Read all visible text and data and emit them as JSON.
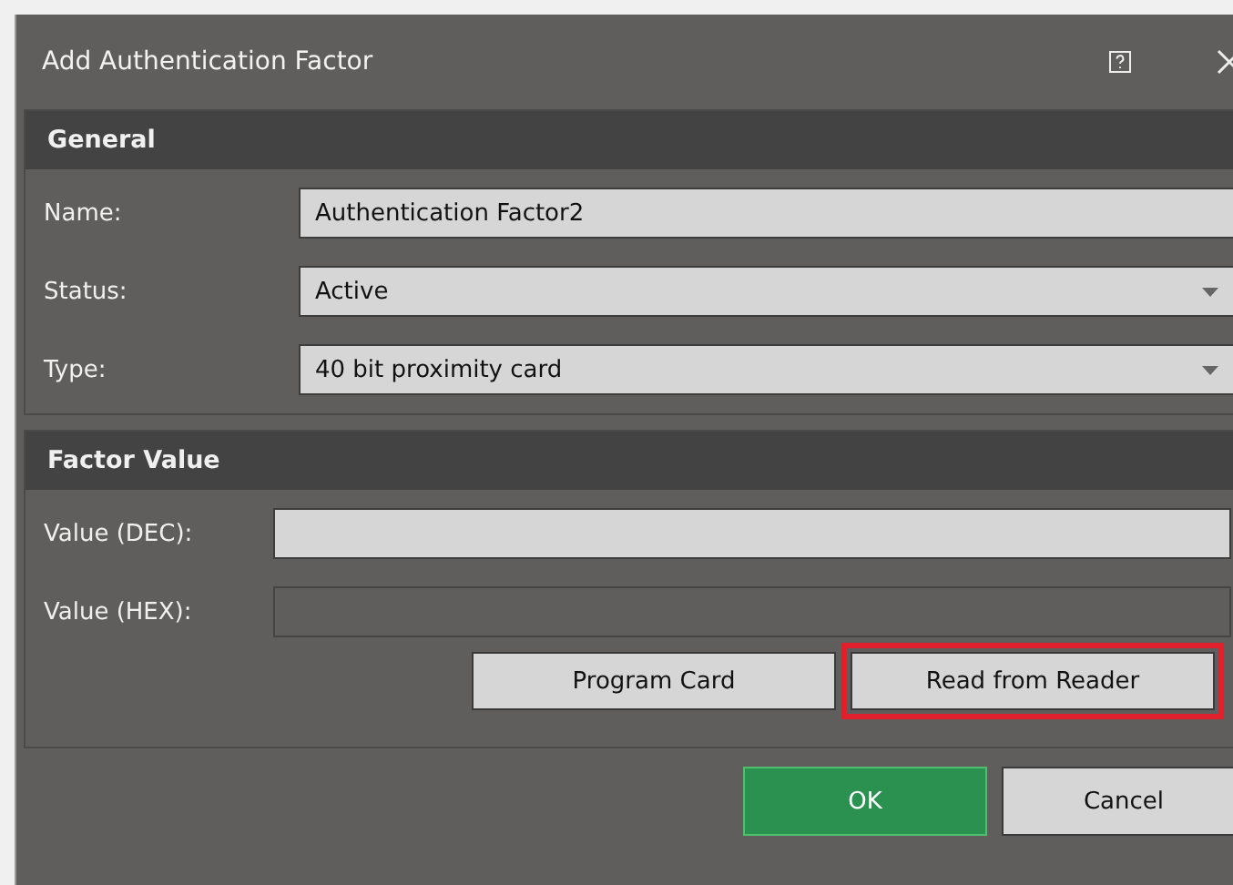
{
  "window": {
    "title": "Add Authentication Factor"
  },
  "sections": [
    {
      "title": "General",
      "fields": [
        {
          "label": "Name:",
          "kind": "text",
          "value": "Authentication Factor2",
          "disabled": false
        },
        {
          "label": "Status:",
          "kind": "dropdown",
          "value": "Active",
          "disabled": false
        },
        {
          "label": "Type:",
          "kind": "dropdown",
          "value": "40 bit proximity card",
          "disabled": false
        }
      ]
    },
    {
      "title": "Factor Value",
      "fields": [
        {
          "label": "Value (DEC):",
          "kind": "text",
          "disabled": false
        },
        {
          "label": "Value (HEX):",
          "kind": "text",
          "disabled": true
        }
      ],
      "buttons": [
        {
          "label": "Program Card",
          "highlighted": false
        },
        {
          "label": "Read from Reader",
          "highlighted": true
        }
      ]
    }
  ],
  "buttons": [
    {
      "label": "OK",
      "kind": "primary"
    },
    {
      "label": "Cancel",
      "kind": "secondary"
    }
  ]
}
